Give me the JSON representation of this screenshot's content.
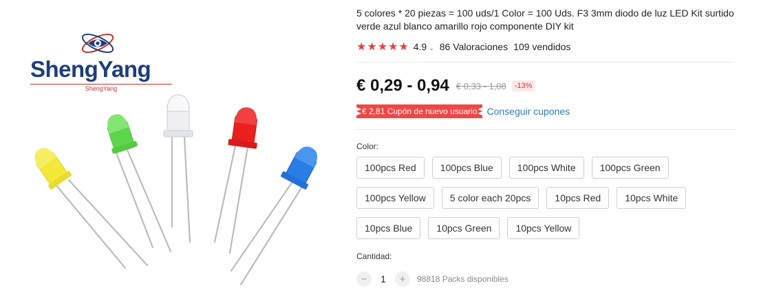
{
  "brand": {
    "name": "ShengYang",
    "sub": "ShengYang"
  },
  "product": {
    "title": "5 colores * 20 piezas = 100 uds/1 Color = 100 Uds. F3 3mm diodo de luz LED Kit surtido verde azul blanco amarillo rojo componente DIY kit",
    "stars": "★★★★★",
    "rating": "4.9",
    "rating_chevron": "⌄",
    "reviews": "86 Valoraciones",
    "sold": "109 vendidos",
    "price": "€ 0,29 - 0,94",
    "old_price": "€ 0,33 - 1,08",
    "discount": "-13%",
    "coupon": "€ 2,81 Cupón de nuevo usuario",
    "coupon_link": "Conseguir cupones",
    "color_label": "Color:",
    "color_options": [
      [
        "100pcs Red",
        "100pcs Blue",
        "100pcs White",
        "100pcs Green"
      ],
      [
        "100pcs Yellow",
        "5 color each 20pcs",
        "10pcs Red",
        "10pcs White"
      ],
      [
        "10pcs Blue",
        "10pcs Green",
        "10pcs Yellow"
      ]
    ],
    "quantity_label": "Cantidad:",
    "quantity_minus": "−",
    "quantity_value": "1",
    "quantity_plus": "+",
    "available": "98818 Packs disponibles"
  },
  "colors": {
    "star": "#e93d3d",
    "coupon_bg": "#f04646",
    "link": "#2e7bb7",
    "brand_blue": "#1e3e7a",
    "brand_red": "#c9302c",
    "led_yellow": "#f3e838",
    "led_green": "#5ed64c",
    "led_white": "#e9ecef",
    "led_red": "#ea1f1f",
    "led_blue": "#2a7de6"
  }
}
